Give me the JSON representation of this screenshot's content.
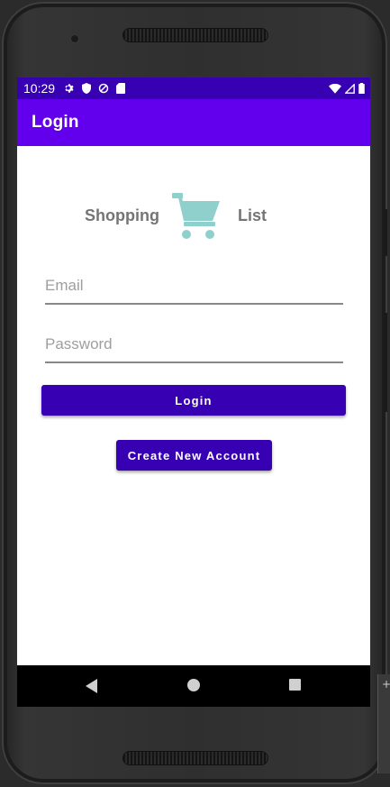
{
  "status_bar": {
    "time": "10:29",
    "left_icons": [
      "gear-icon",
      "shield-icon",
      "data-saver-icon",
      "sd-card-icon"
    ],
    "right_icons": [
      "wifi-icon",
      "signal-icon",
      "battery-icon"
    ]
  },
  "app_bar": {
    "title": "Login"
  },
  "brand": {
    "left_text": "Shopping",
    "right_text": "List",
    "icon": "shopping-cart-icon",
    "icon_color": "#8fcfcc"
  },
  "form": {
    "email": {
      "placeholder": "Email",
      "value": ""
    },
    "password": {
      "placeholder": "Password",
      "value": ""
    }
  },
  "buttons": {
    "login": "Login",
    "create_account": "Create New Account"
  },
  "nav": {
    "icons": [
      "back-icon",
      "home-icon",
      "recents-icon"
    ]
  },
  "colors": {
    "status_bar": "#3700b3",
    "app_bar": "#6200ee",
    "button": "#3700b3",
    "nav_bar": "#000000"
  },
  "emulator_panel": {
    "plus_label": "+"
  }
}
